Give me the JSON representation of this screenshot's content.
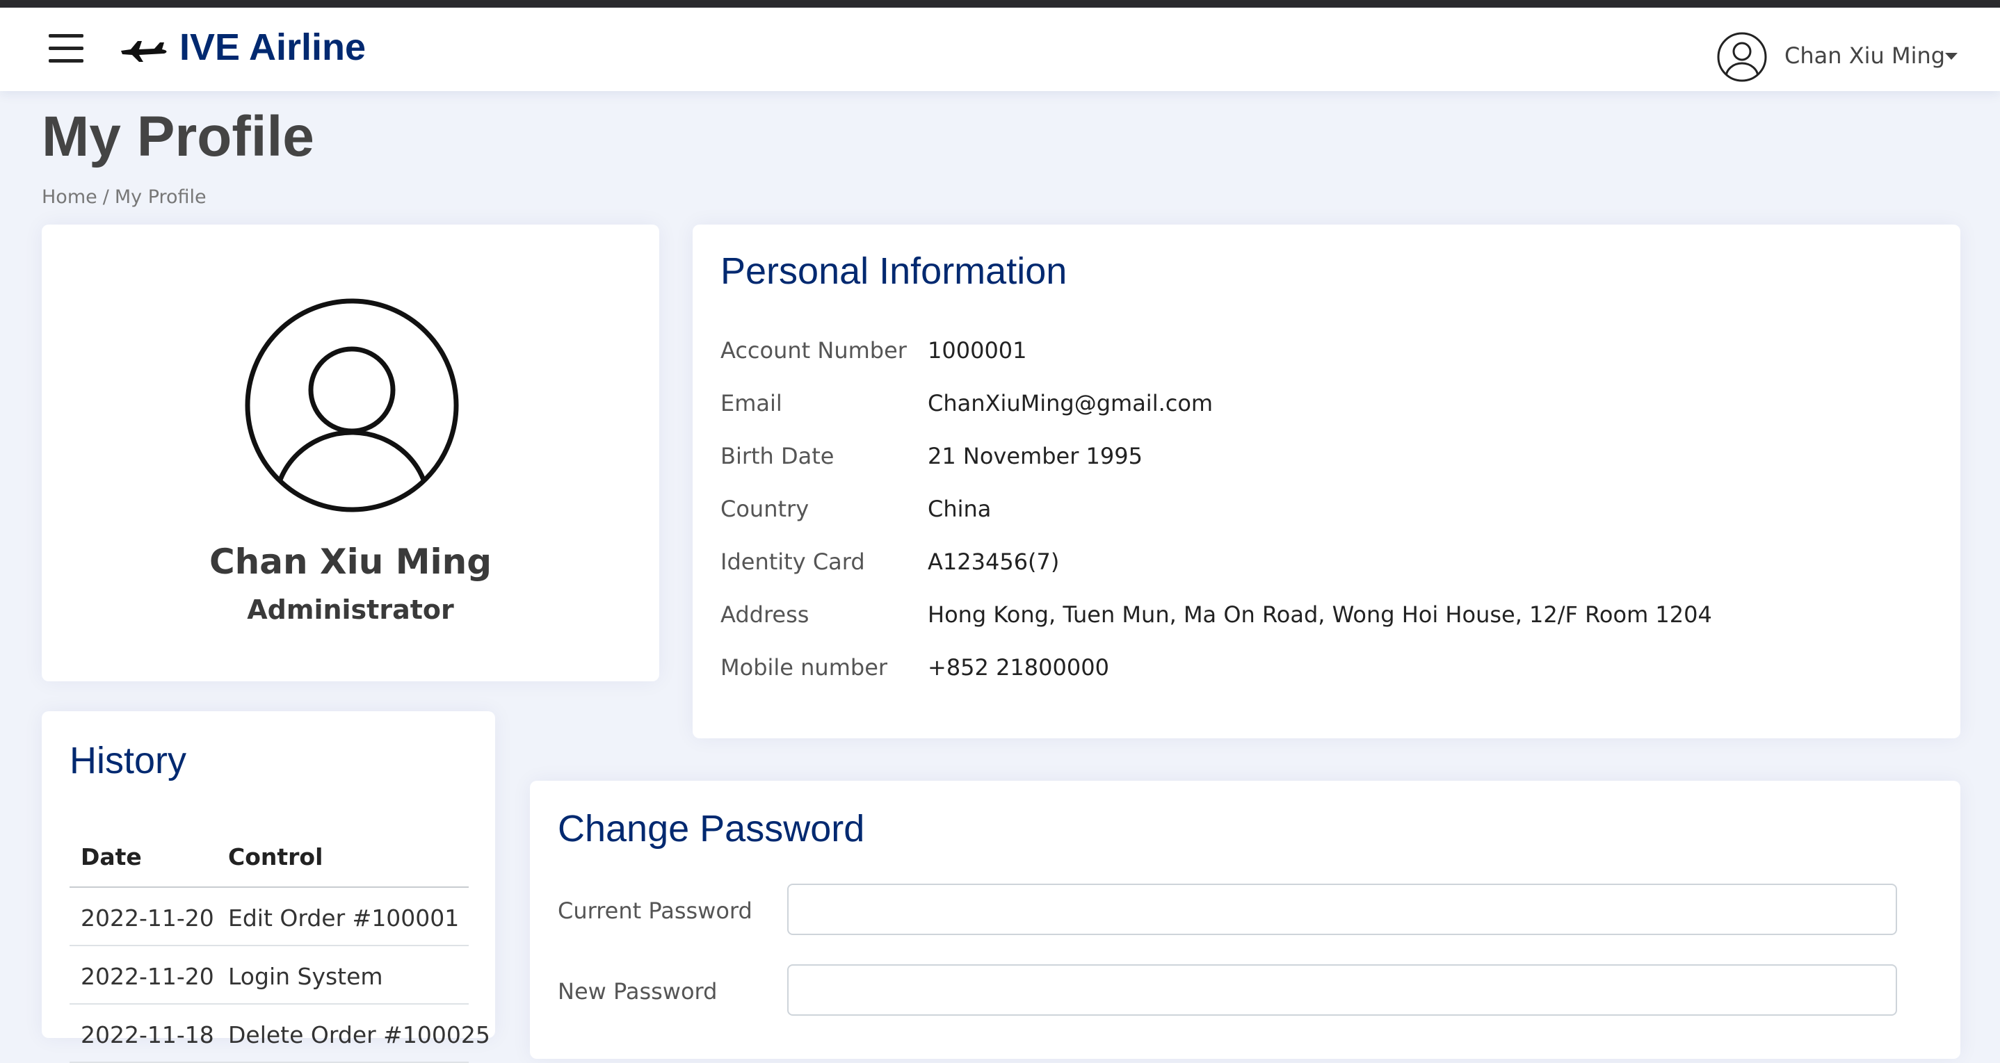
{
  "header": {
    "app_name": "IVE Airline",
    "user_name": "Chan Xiu Ming",
    "icons": [
      "menu-icon",
      "airplane-logo-icon",
      "user-circle-icon",
      "caret-down-icon"
    ]
  },
  "page": {
    "title": "My Profile",
    "breadcrumb": [
      "Home",
      "My Profile"
    ]
  },
  "profile": {
    "name": "Chan Xiu Ming",
    "role": "Administrator"
  },
  "personal_info": {
    "title": "Personal Information",
    "rows": [
      {
        "label": "Account Number",
        "value": "1000001"
      },
      {
        "label": "Email",
        "value": "ChanXiuMing@gmail.com"
      },
      {
        "label": "Birth Date",
        "value": "21 November 1995"
      },
      {
        "label": "Country",
        "value": "China"
      },
      {
        "label": "Identity Card",
        "value": "A123456(7)"
      },
      {
        "label": "Address",
        "value": "Hong Kong, Tuen Mun, Ma On Road, Wong Hoi House, 12/F Room 1204"
      },
      {
        "label": "Mobile number",
        "value": "+852 21800000"
      }
    ]
  },
  "history": {
    "title": "History",
    "columns": [
      "Date",
      "Control"
    ],
    "rows": [
      [
        "2022-11-20",
        "Edit Order #100001"
      ],
      [
        "2022-11-20",
        "Login System"
      ],
      [
        "2022-11-18",
        "Delete Order #100025"
      ]
    ]
  },
  "change_password": {
    "title": "Change Password",
    "current_label": "Current Password",
    "current_value": "",
    "new_label": "New Password",
    "new_value": ""
  },
  "colors": {
    "brand": "#012970",
    "background": "#f0f3fa",
    "card": "#ffffff"
  }
}
